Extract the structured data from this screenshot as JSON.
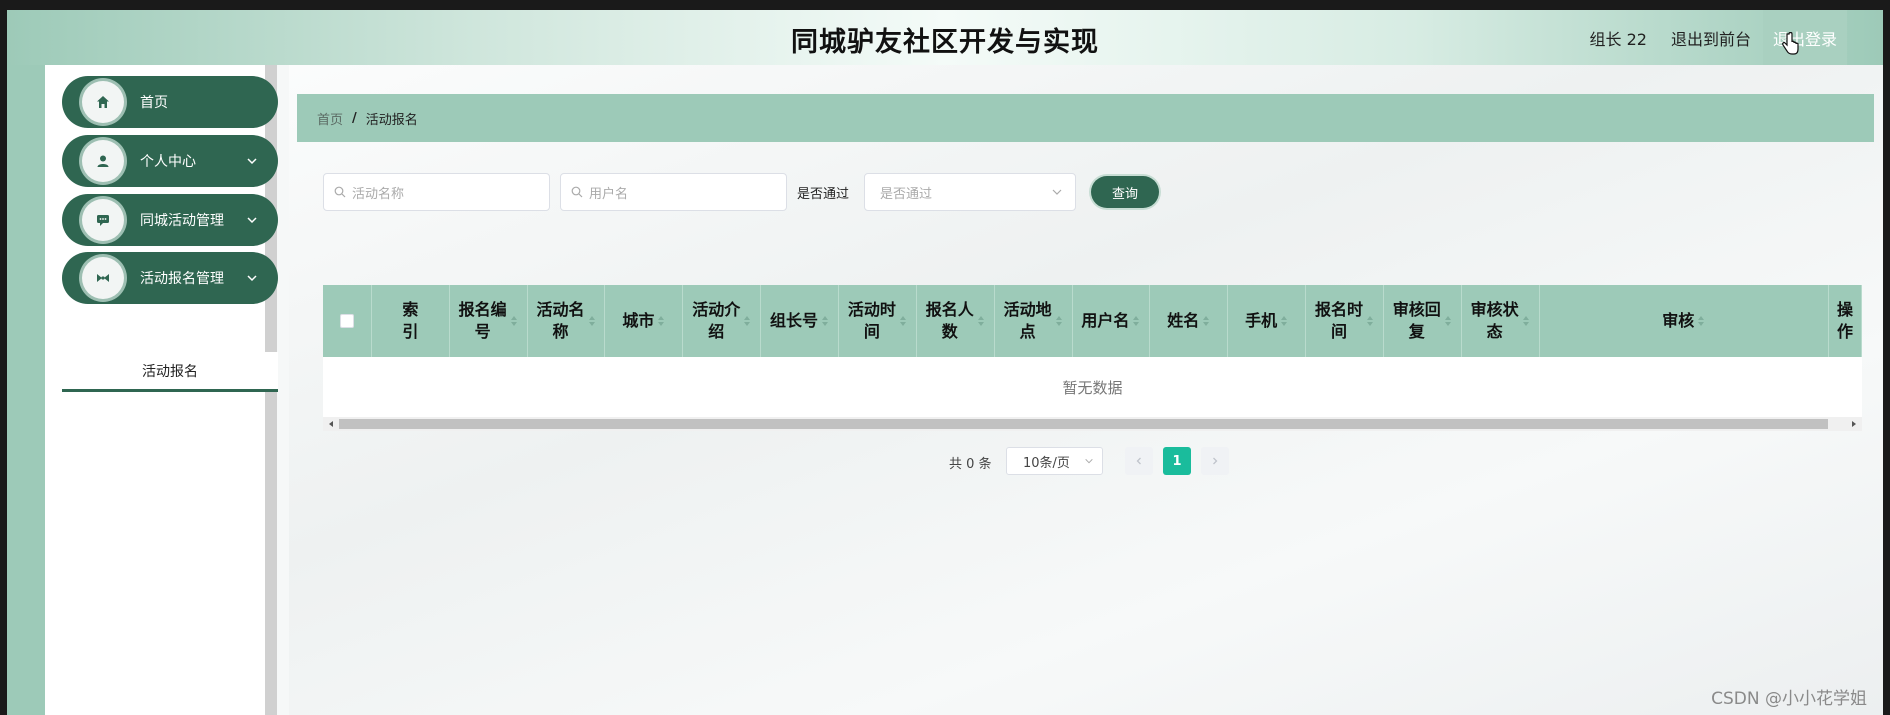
{
  "header": {
    "title": "同城驴友社区开发与实现",
    "user_label": "组长 22",
    "to_front_label": "退出到前台",
    "logout_label": "退出登录"
  },
  "sidebar": {
    "items": [
      {
        "label": "首页",
        "icon": "home-icon",
        "has_submenu": false
      },
      {
        "label": "个人中心",
        "icon": "user-icon",
        "has_submenu": true
      },
      {
        "label": "同城活动管理",
        "icon": "chat-icon",
        "has_submenu": true
      },
      {
        "label": "活动报名管理",
        "icon": "bowtie-icon",
        "has_submenu": true
      }
    ],
    "submenu_active": "活动报名"
  },
  "breadcrumb": {
    "home": "首页",
    "separator": "/",
    "current": "活动报名"
  },
  "search": {
    "activity_placeholder": "活动名称",
    "username_placeholder": "用户名",
    "pass_label": "是否通过",
    "pass_placeholder": "是否通过",
    "query_label": "查询"
  },
  "table": {
    "columns": [
      {
        "label": "索\n引",
        "sortable": false
      },
      {
        "label": "报名编\n号",
        "sortable": true
      },
      {
        "label": "活动名\n称",
        "sortable": true
      },
      {
        "label": "城市",
        "sortable": true
      },
      {
        "label": "活动介\n绍",
        "sortable": true
      },
      {
        "label": "组长号",
        "sortable": true
      },
      {
        "label": "活动时\n间",
        "sortable": true
      },
      {
        "label": "报名人\n数",
        "sortable": true
      },
      {
        "label": "活动地\n点",
        "sortable": true
      },
      {
        "label": "用户名",
        "sortable": true
      },
      {
        "label": "姓名",
        "sortable": true
      },
      {
        "label": "手机",
        "sortable": true
      },
      {
        "label": "报名时\n间",
        "sortable": true
      },
      {
        "label": "审核回\n复",
        "sortable": true
      },
      {
        "label": "审核状\n态",
        "sortable": true
      },
      {
        "label": "审核",
        "sortable": true
      },
      {
        "label": "操作",
        "sortable": false
      }
    ],
    "empty_text": "暂无数据"
  },
  "pagination": {
    "total_text": "共 0 条",
    "page_size": "10条/页",
    "current_page": "1"
  },
  "watermark": "CSDN @小小花学姐",
  "colors": {
    "primary": "#2f6651",
    "accent": "#9dcab8",
    "page_active": "#1abc9c"
  }
}
